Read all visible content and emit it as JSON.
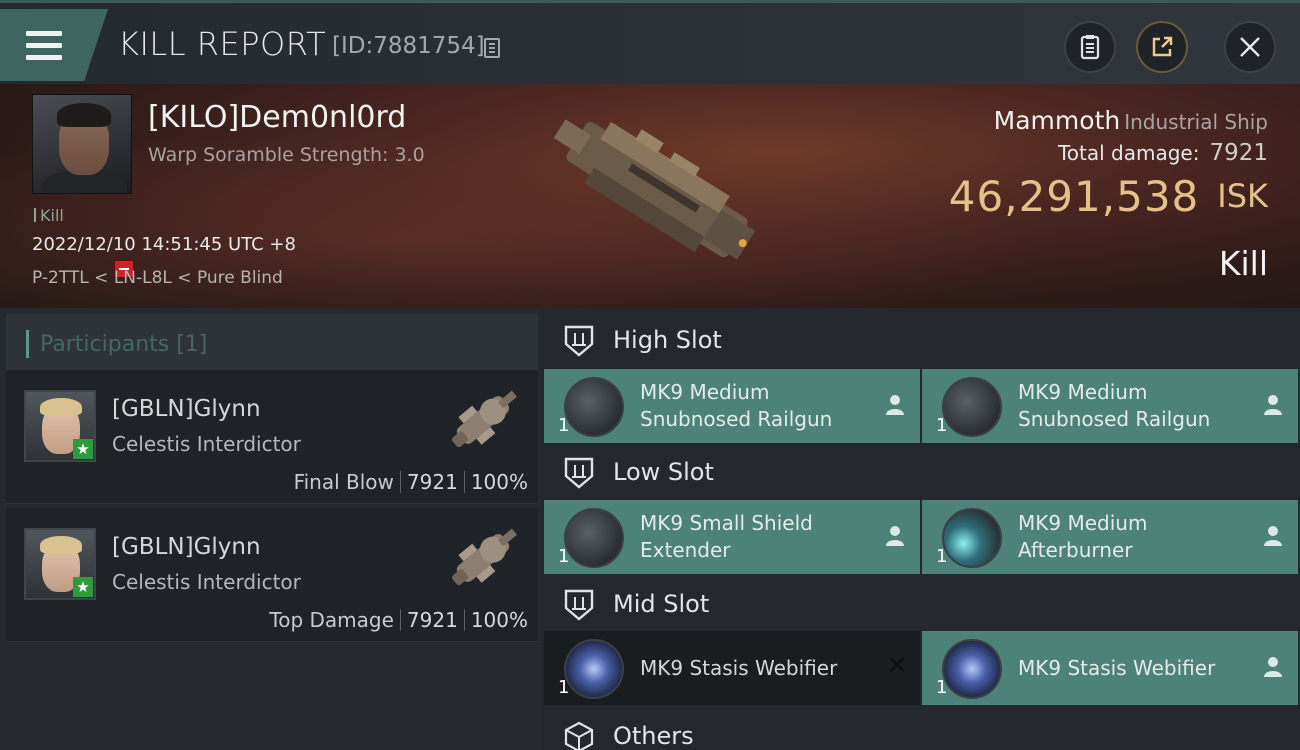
{
  "header": {
    "title": "KILL REPORT",
    "report_id": "[ID:7881754]",
    "icons": [
      "menu-icon",
      "clipboard-icon",
      "share-icon",
      "close-icon"
    ]
  },
  "victim": {
    "name": "[KILO]Dem0nl0rd",
    "warp_scramble": "Warp Soramble Strength: 3.0",
    "kill_tag": "Kill",
    "datetime": "2022/12/10 14:51:45 UTC +8",
    "location": "P-2TTL < LN-L8L < Pure Blind",
    "ship": "Mammoth",
    "ship_class": "Industrial Ship",
    "total_damage_label": "Total damage:",
    "total_damage": "7921",
    "isk_value": "46,291,538",
    "isk_label": "ISK",
    "result": "Kill"
  },
  "participants": {
    "title": "Participants [1]",
    "rows": [
      {
        "name": "[GBLN]Glynn",
        "ship": "Celestis Interdictor",
        "role": "Final Blow",
        "damage": "7921",
        "percent": "100%"
      },
      {
        "name": "[GBLN]Glynn",
        "ship": "Celestis Interdictor",
        "role": "Top Damage",
        "damage": "7921",
        "percent": "100%"
      }
    ]
  },
  "fitting": {
    "high_slot": {
      "label": "High Slot",
      "modules": [
        {
          "name": "MK9 Medium\nSnubnosed Railgun",
          "qty": "1",
          "state": "fitted"
        },
        {
          "name": "MK9 Medium\nSnubnosed Railgun",
          "qty": "1",
          "state": "fitted"
        }
      ]
    },
    "low_slot": {
      "label": "Low Slot",
      "modules": [
        {
          "name": "MK9 Small Shield\nExtender",
          "qty": "1",
          "state": "fitted"
        },
        {
          "name": "MK9 Medium\nAfterburner",
          "qty": "1",
          "state": "fitted"
        }
      ]
    },
    "mid_slot": {
      "label": "Mid Slot",
      "modules": [
        {
          "name": "MK9 Stasis Webifier",
          "qty": "1",
          "state": "destroyed"
        },
        {
          "name": "MK9 Stasis Webifier",
          "qty": "1",
          "state": "fitted"
        }
      ]
    },
    "others": {
      "label": "Others"
    }
  },
  "colors": {
    "accent": "#4c8278",
    "isk": "#e6c08a",
    "badge_red": "#c8242a",
    "badge_green": "#2f9a3b"
  }
}
